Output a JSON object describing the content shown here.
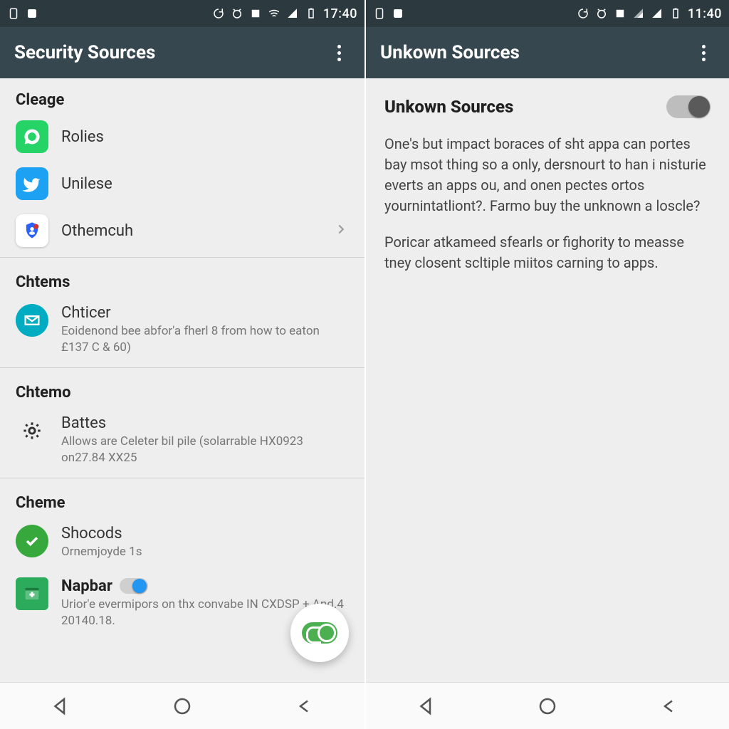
{
  "left": {
    "status": {
      "time": "17:40"
    },
    "appbar": {
      "title": "Security Sources"
    },
    "sections": [
      {
        "header": "Cleage",
        "items": [
          {
            "title": "Rolies"
          },
          {
            "title": "Unilese"
          },
          {
            "title": "Othemcuh",
            "chevron": true
          }
        ]
      },
      {
        "header": "Chtems",
        "items": [
          {
            "title": "Chticer",
            "sub": "Eoidenond bee abfor'a fherl 8 from how to eaton £137 C & 60)"
          }
        ]
      },
      {
        "header": "Chtemo",
        "items": [
          {
            "title": "Battes",
            "sub": "Allows are Celeter bil pile (solarrable HX0923 on27.84 XX25"
          }
        ]
      },
      {
        "header": "Cheme",
        "items": [
          {
            "title": "Shocods",
            "sub": "Ornemjoyde 1s"
          },
          {
            "title": "Napbar",
            "sub": "Urior'e evermipors on thx convabe IN CXDSP + And.4 20140.18.",
            "mini_toggle": true
          }
        ]
      }
    ]
  },
  "right": {
    "status": {
      "time": "11:40"
    },
    "appbar": {
      "title": "Unkown Sources"
    },
    "detail": {
      "title": "Unkown Sources",
      "p1": "One's but impact boraces of sht appa can portes bay msot thing so a only, dersnourt to han i nisturie everts an apps ou, and onen pectes ortos yournintatliont?. Farmo buy the unknown a loscle?",
      "p2": "Poricar atkameed sfearls or fighority to measse tney closent scltiple miitos carning to apps."
    }
  }
}
